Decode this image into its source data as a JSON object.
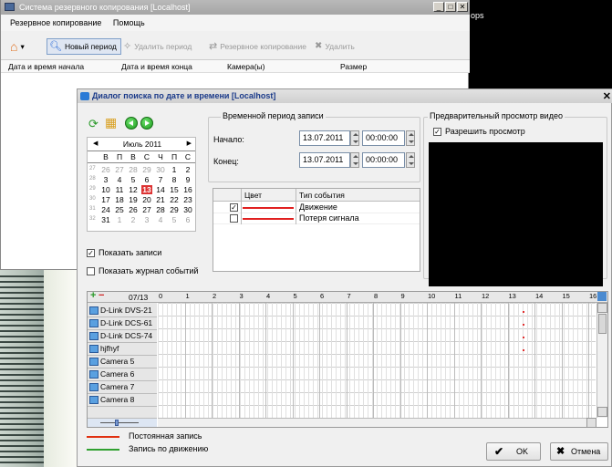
{
  "desktop": {
    "black_text": "ops"
  },
  "bg_window": {
    "title": "Система резервного копирования [Localhost]",
    "menu": [
      "Резервное копирование",
      "Помощь"
    ],
    "toolbar": {
      "new_period": "Новый период",
      "delete_period": "Удалить период",
      "backup": "Резервное копирование",
      "delete": "Удалить"
    },
    "columns": [
      "Дата и время начала",
      "Дата и время конца",
      "Камера(ы)",
      "Размер"
    ]
  },
  "dialog": {
    "title": "Диалог поиска по дате и времени [Localhost]",
    "calendar": {
      "month_label": "Июль 2011",
      "weekdays": [
        "В",
        "П",
        "В",
        "С",
        "Ч",
        "П",
        "С"
      ],
      "weeks": [
        {
          "num": "27",
          "days": [
            "26",
            "27",
            "28",
            "29",
            "30",
            "1",
            "2"
          ]
        },
        {
          "num": "28",
          "days": [
            "3",
            "4",
            "5",
            "6",
            "7",
            "8",
            "9"
          ]
        },
        {
          "num": "29",
          "days": [
            "10",
            "11",
            "12",
            "13",
            "14",
            "15",
            "16"
          ]
        },
        {
          "num": "30",
          "days": [
            "17",
            "18",
            "19",
            "20",
            "21",
            "22",
            "23"
          ]
        },
        {
          "num": "31",
          "days": [
            "24",
            "25",
            "26",
            "27",
            "28",
            "29",
            "30"
          ]
        },
        {
          "num": "32",
          "days": [
            "31",
            "1",
            "2",
            "3",
            "4",
            "5",
            "6"
          ]
        }
      ],
      "selected_day": "13"
    },
    "show_records": "Показать записи",
    "show_event_log": "Показать журнал событий",
    "period": {
      "title": "Временной период записи",
      "start_label": "Начало:",
      "start_date": "13.07.2011",
      "start_time": "00:00:00",
      "end_label": "Конец:",
      "end_date": "13.07.2011",
      "end_time": "00:00:00"
    },
    "events": {
      "col_color": "Цвет",
      "col_type": "Тип события",
      "rows": [
        {
          "checked": "✓",
          "color": "#e02020",
          "label": "Движение"
        },
        {
          "checked": "",
          "color": "#e02020",
          "label": "Потеря сигнала"
        }
      ]
    },
    "preview": {
      "title": "Предварительный просмотр видео",
      "enable": "Разрешить просмотр"
    },
    "timeline": {
      "date": "07/13",
      "hours": [
        "0",
        "1",
        "2",
        "3",
        "4",
        "5",
        "6",
        "7",
        "8",
        "9",
        "10",
        "11",
        "12",
        "13",
        "14",
        "15",
        "16"
      ],
      "cameras": [
        "D-Link DVS-21",
        "D-Link DCS-61",
        "D-Link DCS-74",
        "hjfhyf",
        "Camera 5",
        "Camera 6",
        "Camera 7",
        "Camera 8"
      ]
    },
    "legend": [
      {
        "color": "#e03010",
        "label": "Постоянная запись"
      },
      {
        "color": "#30a030",
        "label": "Запись по движению"
      }
    ],
    "ok": "OK",
    "cancel": "Отмена"
  }
}
